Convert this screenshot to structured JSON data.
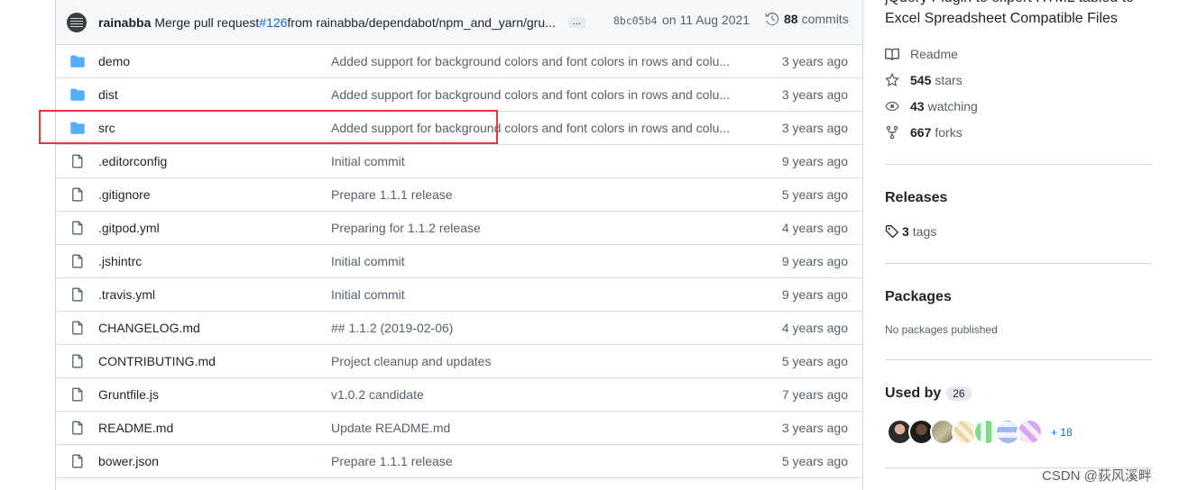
{
  "commit": {
    "author": "rainabba",
    "message_prefix": "Merge pull request ",
    "pr": "#126",
    "message_suffix": " from rainabba/dependabot/npm_and_yarn/gru...",
    "dots": "...",
    "sha": "8bc05b4",
    "date": "on 11 Aug 2021",
    "count": "88",
    "count_label": "commits"
  },
  "files": [
    {
      "type": "dir",
      "name": "demo",
      "message": "Added support for background colors and font colors in rows and colu...",
      "age": "3 years ago"
    },
    {
      "type": "dir",
      "name": "dist",
      "message": "Added support for background colors and font colors in rows and colu...",
      "age": "3 years ago"
    },
    {
      "type": "dir",
      "name": "src",
      "message": "Added support for background colors and font colors in rows and colu...",
      "age": "3 years ago"
    },
    {
      "type": "file",
      "name": ".editorconfig",
      "message": "Initial commit",
      "age": "9 years ago"
    },
    {
      "type": "file",
      "name": ".gitignore",
      "message": "Prepare 1.1.1 release",
      "age": "5 years ago"
    },
    {
      "type": "file",
      "name": ".gitpod.yml",
      "message": "Preparing for 1.1.2 release",
      "age": "4 years ago"
    },
    {
      "type": "file",
      "name": ".jshintrc",
      "message": "Initial commit",
      "age": "9 years ago"
    },
    {
      "type": "file",
      "name": ".travis.yml",
      "message": "Initial commit",
      "age": "9 years ago"
    },
    {
      "type": "file",
      "name": "CHANGELOG.md",
      "message": "## 1.1.2 (2019-02-06)",
      "age": "4 years ago"
    },
    {
      "type": "file",
      "name": "CONTRIBUTING.md",
      "message": "Project cleanup and updates",
      "age": "5 years ago"
    },
    {
      "type": "file",
      "name": "Gruntfile.js",
      "message": "v1.0.2 candidate",
      "age": "7 years ago"
    },
    {
      "type": "file",
      "name": "README.md",
      "message": "Update README.md",
      "age": "3 years ago"
    },
    {
      "type": "file",
      "name": "bower.json",
      "message": "Prepare 1.1.1 release",
      "age": "5 years ago"
    }
  ],
  "sidebar": {
    "about_line1": "jQuery Plugin to export HTML tabled to",
    "about_line2": "Excel Spreadsheet Compatible Files",
    "readme": "Readme",
    "stars_count": "545",
    "stars_label": "stars",
    "watching_count": "43",
    "watching_label": "watching",
    "forks_count": "667",
    "forks_label": "forks",
    "releases_title": "Releases",
    "tags_count": "3",
    "tags_label": "tags",
    "packages_title": "Packages",
    "packages_empty": "No packages published",
    "used_by_title": "Used by",
    "used_by_count": "26",
    "used_by_more": "+ 18"
  },
  "watermark": "CSDN @荻风溪畔",
  "colors": {
    "folder": "#54aeff",
    "link": "#0969da",
    "highlight": "#e53935"
  }
}
